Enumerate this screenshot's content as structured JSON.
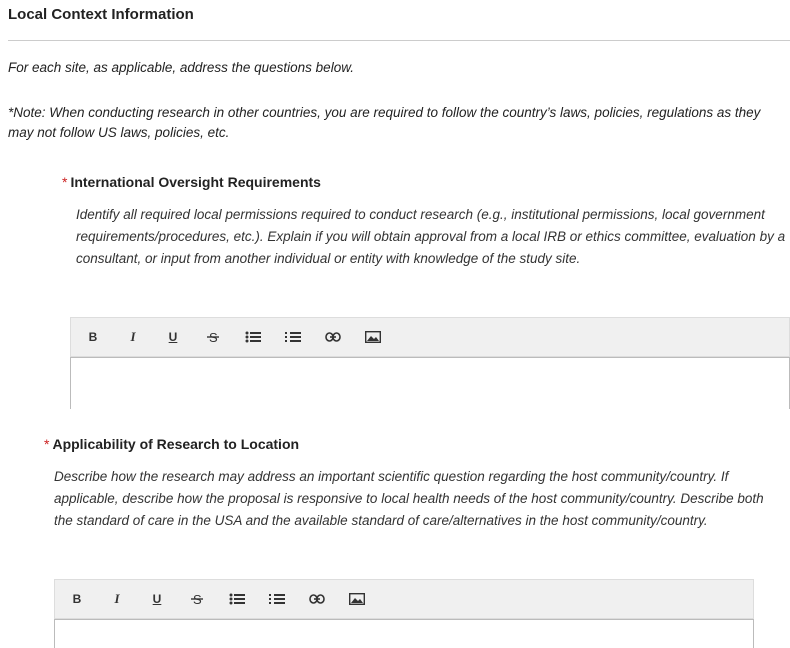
{
  "section": {
    "title": "Local Context Information",
    "intro": "For each site, as applicable, address the questions below.",
    "note": "*Note: When conducting research in other countries, you are required to follow the country’s laws, policies, regulations as they may not follow US laws, policies, etc."
  },
  "questions": [
    {
      "required_marker": "*",
      "title": "International Oversight Requirements",
      "description": "Identify all required local permissions required to conduct research (e.g., institutional permissions, local government requirements/procedures, etc.). Explain if you will obtain approval from a local IRB or ethics committee, evaluation by a consultant, or input from another individual or entity with knowledge of the study site."
    },
    {
      "required_marker": "*",
      "title": "Applicability of Research to Location",
      "description": "Describe how the research may address an important scientific question regarding the host community/country. If applicable, describe how the proposal is responsive to local health needs of the host community/country. Describe both the standard of care in the USA and the available standard of care/alternatives in the host community/country."
    }
  ],
  "toolbar": {
    "bold": "B",
    "italic": "I",
    "underline": "U",
    "strike": "S",
    "icons": [
      "bold-icon",
      "italic-icon",
      "underline-icon",
      "strikethrough-icon",
      "bulleted-list-icon",
      "numbered-list-icon",
      "link-icon",
      "image-icon"
    ]
  },
  "editors": [
    {
      "value": ""
    },
    {
      "value": ""
    }
  ]
}
